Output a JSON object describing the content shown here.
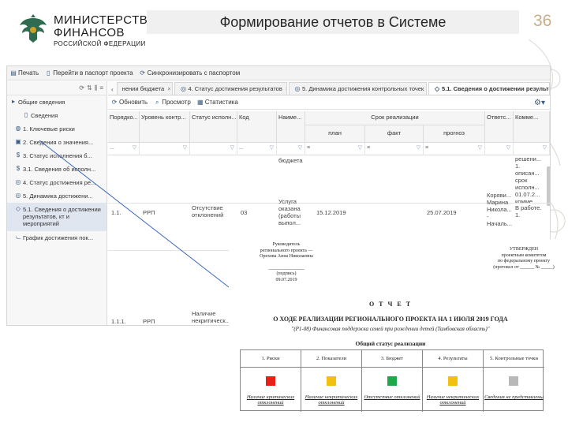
{
  "header": {
    "logo_line1": "МИНИСТЕРСТВО",
    "logo_line2": "ФИНАНСОВ",
    "logo_line3": "РОССИЙСКОЙ ФЕДЕРАЦИИ",
    "title": "Формирование отчетов в Системе",
    "slide_number": "36"
  },
  "toolbar": {
    "print": "Печать",
    "goto_passport": "Перейти в паспорт проекта",
    "sync": "Синхронизировать с паспортом"
  },
  "sidebar": {
    "items": [
      {
        "label": "Общие сведения",
        "icon": "folder-icon"
      },
      {
        "label": "Сведения",
        "icon": "document-icon"
      },
      {
        "label": "1. Ключевые риски",
        "icon": "risk-icon"
      },
      {
        "label": "2. Сведения о значения...",
        "icon": "clipboard-icon"
      },
      {
        "label": "3. Статус исполнения б...",
        "icon": "budget-icon"
      },
      {
        "label": "3.1. Сведения об исполн...",
        "icon": "budget-icon"
      },
      {
        "label": "4. Статус достижения ре...",
        "icon": "target-icon"
      },
      {
        "label": "5. Динамика достижени...",
        "icon": "target-icon"
      },
      {
        "label": "5.1. Сведения о достижении результатов, кт и мероприятий",
        "icon": "shield-icon"
      },
      {
        "label": "График достижения пок...",
        "icon": "chart-icon"
      }
    ]
  },
  "tabs": [
    {
      "label": "нении бюджета"
    },
    {
      "label": "4. Статус достижения результатов"
    },
    {
      "label": "5. Динамика достижения контрольных точек"
    },
    {
      "label": "5.1. Сведения о достижении результатов, кт и ме..."
    }
  ],
  "actions": {
    "refresh": "Обновить",
    "view": "Просмотр",
    "stats": "Статистика"
  },
  "grid": {
    "columns": [
      "Порядко...",
      "Уровень контр...",
      "Статус исполн...",
      "Код",
      "Наиме...",
      "Срок реализации",
      "Ответс...",
      "Комме..."
    ],
    "subcolumns": [
      "план",
      "факт",
      "прогноз"
    ],
    "filter_value": "...",
    "row0": {
      "name": "бюджета",
      "comment": "решени... 1. описан... срок исполн... 01.07.2... комме..."
    },
    "row1": {
      "num": "1.1.",
      "level": "РРП",
      "status": "Отсутствие отклонений",
      "code": "03",
      "name": "Услуга оказана (работы выпол...",
      "plan": "15.12.2019",
      "forecast": "25.07.2019",
      "responsible": "Коряви... Марина Никола... - Началь...",
      "comment": "В работе. 1."
    },
    "row2": {
      "num": "1.1.1.",
      "level": "РРП",
      "status": "Наличие некритическ..."
    }
  },
  "document": {
    "left_block": [
      "Руководитель",
      "регионального проекта —",
      "Орехова Анна Николаевна",
      "",
      "_______________",
      "(подпись)",
      "09.07.2019"
    ],
    "right_block": [
      "УТВЕРЖДЕН",
      "проектным комитетом",
      "по федеральному проекту",
      "(протокол от ______ № _____)"
    ],
    "title": "О Т Ч Е Т",
    "subtitle": "О ХОДЕ РЕАЛИЗАЦИИ РЕГИОНАЛЬНОГО ПРОЕКТА НА 1 ИЮЛЯ 2019 ГОДА",
    "project": "\"(Р1-08) Финансовая поддержка семей при рождении детей (Тамбовская область)\"",
    "status_title": "Общий статус реализации",
    "status_columns": [
      {
        "label": "1. Риски",
        "color": "#e8201a",
        "note": "Наличие критических отклонений"
      },
      {
        "label": "2. Показатели",
        "color": "#f2c10f",
        "note": "Наличие некритических отклонений"
      },
      {
        "label": "3. Бюджет",
        "color": "#1fa84a",
        "note": "Отсутствие отклонений"
      },
      {
        "label": "4. Результаты",
        "color": "#f2c10f",
        "note": "Наличие некритических отклонений"
      },
      {
        "label": "5. Контрольные точки",
        "color": "#b8b8b8",
        "note": "Сведения не представлены"
      }
    ]
  }
}
